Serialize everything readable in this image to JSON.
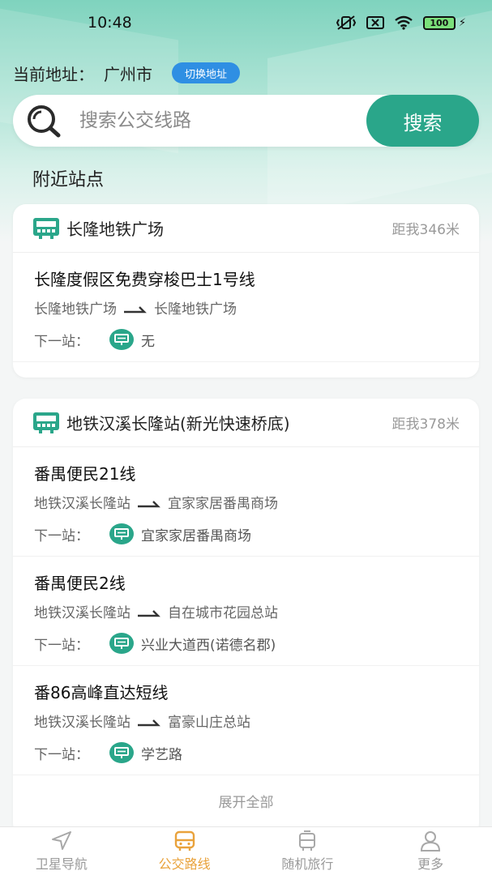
{
  "status_bar": {
    "time": "10:48",
    "battery": "100"
  },
  "address": {
    "label": "当前地址：",
    "city": "广州市",
    "switch_label": "切换地址"
  },
  "search": {
    "placeholder": "搜索公交线路",
    "button_label": "搜索"
  },
  "section_title": "附近站点",
  "next_stop_label": "下一站：",
  "stops": [
    {
      "name": "长隆地铁广场",
      "distance": "距我346米",
      "routes": [
        {
          "name": "长隆度假区免费穿梭巴士1号线",
          "from": "长隆地铁广场",
          "to": "长隆地铁广场",
          "next": "无"
        }
      ]
    },
    {
      "name": "地铁汉溪长隆站(新光快速桥底)",
      "distance": "距我378米",
      "routes": [
        {
          "name": "番禺便民21线",
          "from": "地铁汉溪长隆站",
          "to": "宜家家居番禺商场",
          "next": "宜家家居番禺商场"
        },
        {
          "name": "番禺便民2线",
          "from": "地铁汉溪长隆站",
          "to": "自在城市花园总站",
          "next": "兴业大道西(诺德名郡)"
        },
        {
          "name": "番86高峰直达短线",
          "from": "地铁汉溪长隆站",
          "to": "富豪山庄总站",
          "next": "学艺路"
        }
      ],
      "expand_label": "展开全部"
    }
  ],
  "bottom_nav": [
    {
      "label": "卫星导航",
      "icon": "navigation-arrow-icon",
      "active": false
    },
    {
      "label": "公交路线",
      "icon": "bus-icon",
      "active": true
    },
    {
      "label": "随机旅行",
      "icon": "travel-bus-icon",
      "active": false
    },
    {
      "label": "更多",
      "icon": "user-icon",
      "active": false
    }
  ],
  "colors": {
    "accent": "#2aa68a",
    "switch_button": "#2f8fe3",
    "active_tab": "#e9a23b"
  }
}
